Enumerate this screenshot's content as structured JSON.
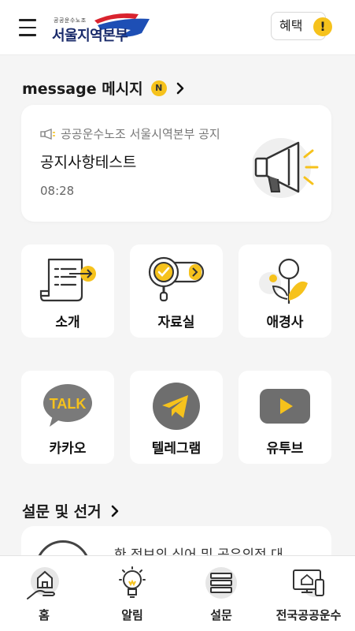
{
  "header": {
    "logo_small": "공공운수노조",
    "logo_main": "서울지역본부",
    "benefit_label": "혜택",
    "alert_mark": "!"
  },
  "message_section": {
    "title": "message 메시지",
    "badge": "N"
  },
  "notice": {
    "source": "공공운수노조 서울시역본부 공지",
    "title": "공지사항테스트",
    "time": "08:28"
  },
  "tiles": [
    {
      "label": "소개",
      "icon": "document-icon"
    },
    {
      "label": "자료실",
      "icon": "magnifier-check-icon"
    },
    {
      "label": "애경사",
      "icon": "flower-icon"
    },
    {
      "label": "카카오",
      "icon": "kakao-talk-icon",
      "icon_text": "TALK"
    },
    {
      "label": "텔레그램",
      "icon": "telegram-icon"
    },
    {
      "label": "유투브",
      "icon": "youtube-icon"
    }
  ],
  "survey_section": {
    "title": "설문 및 선거",
    "card_text": "한 정보의 식어 및 공유의정 대"
  },
  "bottom_nav": [
    {
      "label": "홈",
      "icon": "home-hand-icon"
    },
    {
      "label": "알림",
      "icon": "lightbulb-icon"
    },
    {
      "label": "설문",
      "icon": "stack-icon"
    },
    {
      "label": "전국공공운수",
      "icon": "devices-icon"
    }
  ],
  "colors": {
    "accent": "#f6c21c",
    "background": "#f5f5f5",
    "logo_blue": "#1a2b6b",
    "logo_red": "#d9232e"
  }
}
